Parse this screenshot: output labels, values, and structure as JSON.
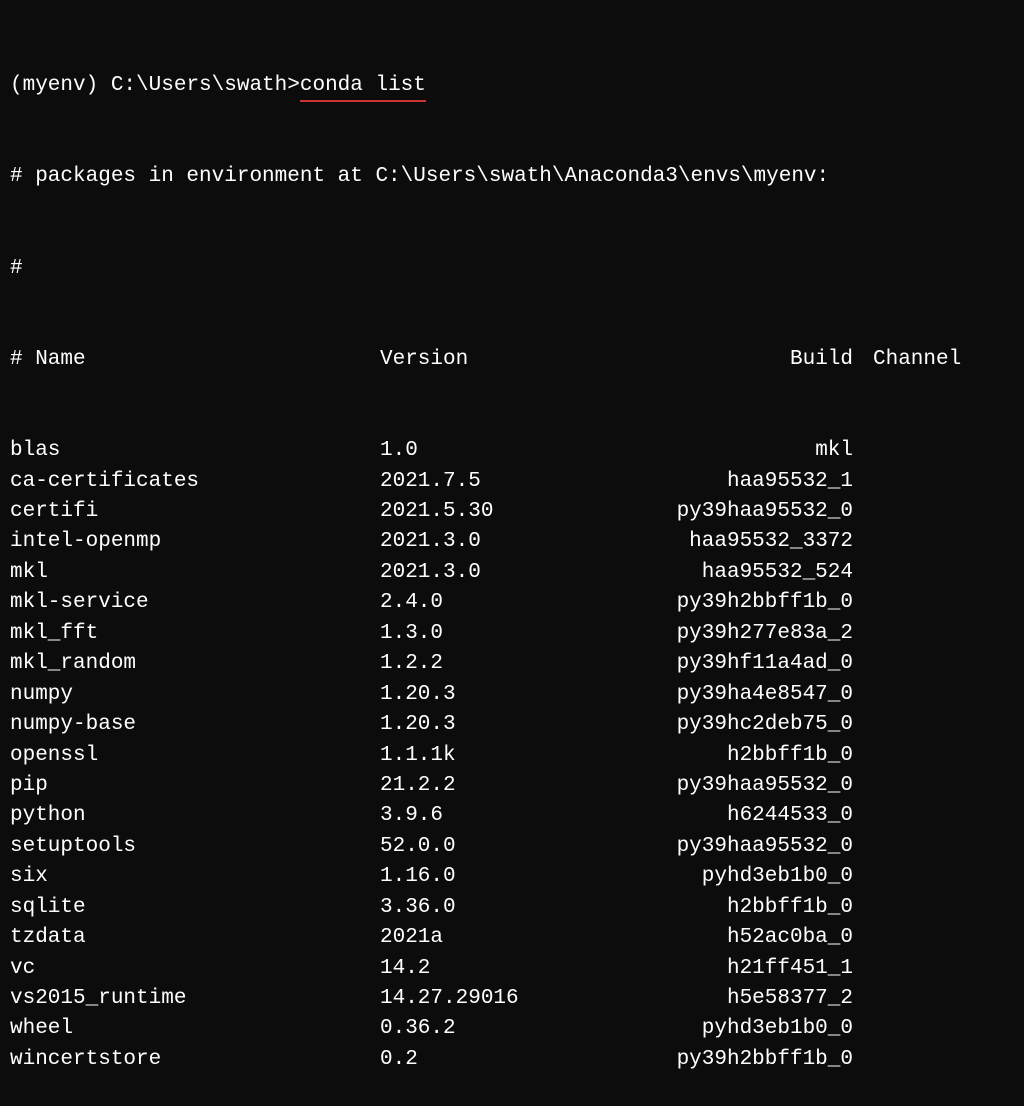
{
  "prompt": {
    "env": "(myenv)",
    "path": "C:\\Users\\swath>",
    "command": "conda list"
  },
  "env_path_line": "# packages in environment at C:\\Users\\swath\\Anaconda3\\envs\\myenv:",
  "hash_line": "#",
  "header": {
    "name": "# Name",
    "version": "Version",
    "build": "Build",
    "channel": "Channel"
  },
  "packages": [
    {
      "name": "blas",
      "version": "1.0",
      "build": "mkl",
      "channel": ""
    },
    {
      "name": "ca-certificates",
      "version": "2021.7.5",
      "build": "haa95532_1",
      "channel": ""
    },
    {
      "name": "certifi",
      "version": "2021.5.30",
      "build": "py39haa95532_0",
      "channel": ""
    },
    {
      "name": "intel-openmp",
      "version": "2021.3.0",
      "build": "haa95532_3372",
      "channel": ""
    },
    {
      "name": "mkl",
      "version": "2021.3.0",
      "build": "haa95532_524",
      "channel": ""
    },
    {
      "name": "mkl-service",
      "version": "2.4.0",
      "build": "py39h2bbff1b_0",
      "channel": ""
    },
    {
      "name": "mkl_fft",
      "version": "1.3.0",
      "build": "py39h277e83a_2",
      "channel": ""
    },
    {
      "name": "mkl_random",
      "version": "1.2.2",
      "build": "py39hf11a4ad_0",
      "channel": ""
    },
    {
      "name": "numpy",
      "version": "1.20.3",
      "build": "py39ha4e8547_0",
      "channel": ""
    },
    {
      "name": "numpy-base",
      "version": "1.20.3",
      "build": "py39hc2deb75_0",
      "channel": ""
    },
    {
      "name": "openssl",
      "version": "1.1.1k",
      "build": "h2bbff1b_0",
      "channel": ""
    },
    {
      "name": "pip",
      "version": "21.2.2",
      "build": "py39haa95532_0",
      "channel": ""
    },
    {
      "name": "python",
      "version": "3.9.6",
      "build": "h6244533_0",
      "channel": ""
    },
    {
      "name": "setuptools",
      "version": "52.0.0",
      "build": "py39haa95532_0",
      "channel": ""
    },
    {
      "name": "six",
      "version": "1.16.0",
      "build": "pyhd3eb1b0_0",
      "channel": ""
    },
    {
      "name": "sqlite",
      "version": "3.36.0",
      "build": "h2bbff1b_0",
      "channel": ""
    },
    {
      "name": "tzdata",
      "version": "2021a",
      "build": "h52ac0ba_0",
      "channel": ""
    },
    {
      "name": "vc",
      "version": "14.2",
      "build": "h21ff451_1",
      "channel": ""
    },
    {
      "name": "vs2015_runtime",
      "version": "14.27.29016",
      "build": "h5e58377_2",
      "channel": ""
    },
    {
      "name": "wheel",
      "version": "0.36.2",
      "build": "pyhd3eb1b0_0",
      "channel": ""
    },
    {
      "name": "wincertstore",
      "version": "0.2",
      "build": "py39h2bbff1b_0",
      "channel": ""
    }
  ]
}
